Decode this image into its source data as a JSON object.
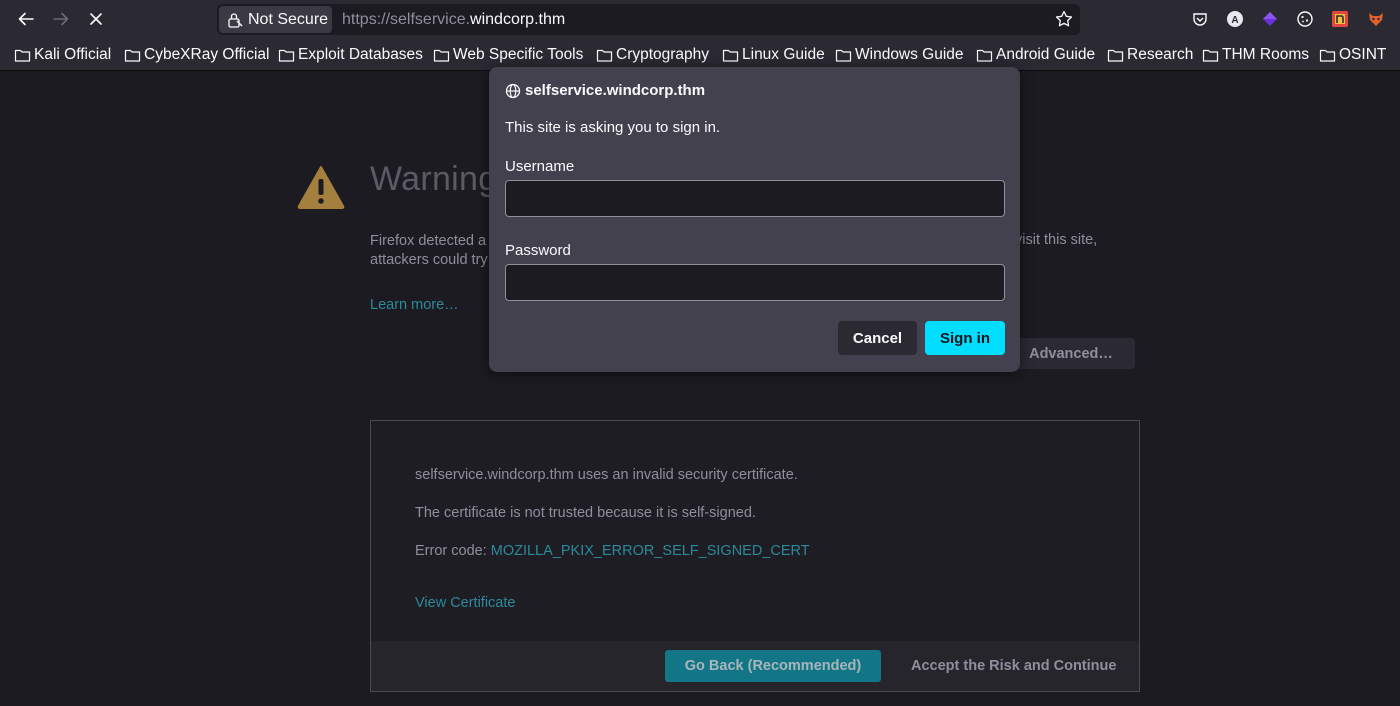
{
  "toolbar": {
    "url_badge": "Not Secure",
    "url_prefix": "https://selfservice.",
    "url_host": "windcorp.thm"
  },
  "bookmarks": [
    {
      "label": "Kali Official"
    },
    {
      "label": "CybeXRay Official"
    },
    {
      "label": "Exploit Databases"
    },
    {
      "label": "Web Specific Tools"
    },
    {
      "label": "Cryptography"
    },
    {
      "label": "Linux Guide"
    },
    {
      "label": "Windows Guide"
    },
    {
      "label": "Android Guide"
    },
    {
      "label": "Research"
    },
    {
      "label": "THM Rooms"
    },
    {
      "label": "OSINT"
    }
  ],
  "warning": {
    "title": "Warning",
    "text_start": "Firefox detected a",
    "text_line2": "attackers could try",
    "text_right": "visit this site,",
    "learn_more": "Learn more…",
    "advanced": "Advanced…"
  },
  "advanced_panel": {
    "line1": "selfservice.windcorp.thm uses an invalid security certificate.",
    "line2": "The certificate is not trusted because it is self-signed.",
    "error_prefix": "Error code: ",
    "error_code": "MOZILLA_PKIX_ERROR_SELF_SIGNED_CERT",
    "view_certificate": "View Certificate",
    "go_back": "Go Back (Recommended)",
    "accept_risk": "Accept the Risk and Continue"
  },
  "dialog": {
    "host": "selfservice.windcorp.thm",
    "message": "This site is asking you to sign in.",
    "username_label": "Username",
    "username_value": "",
    "password_label": "Password",
    "password_value": "",
    "cancel": "Cancel",
    "sign_in": "Sign in"
  },
  "colors": {
    "accent": "#00ddff",
    "warning_icon": "#a47f3d",
    "link": "#2b8a9b"
  }
}
